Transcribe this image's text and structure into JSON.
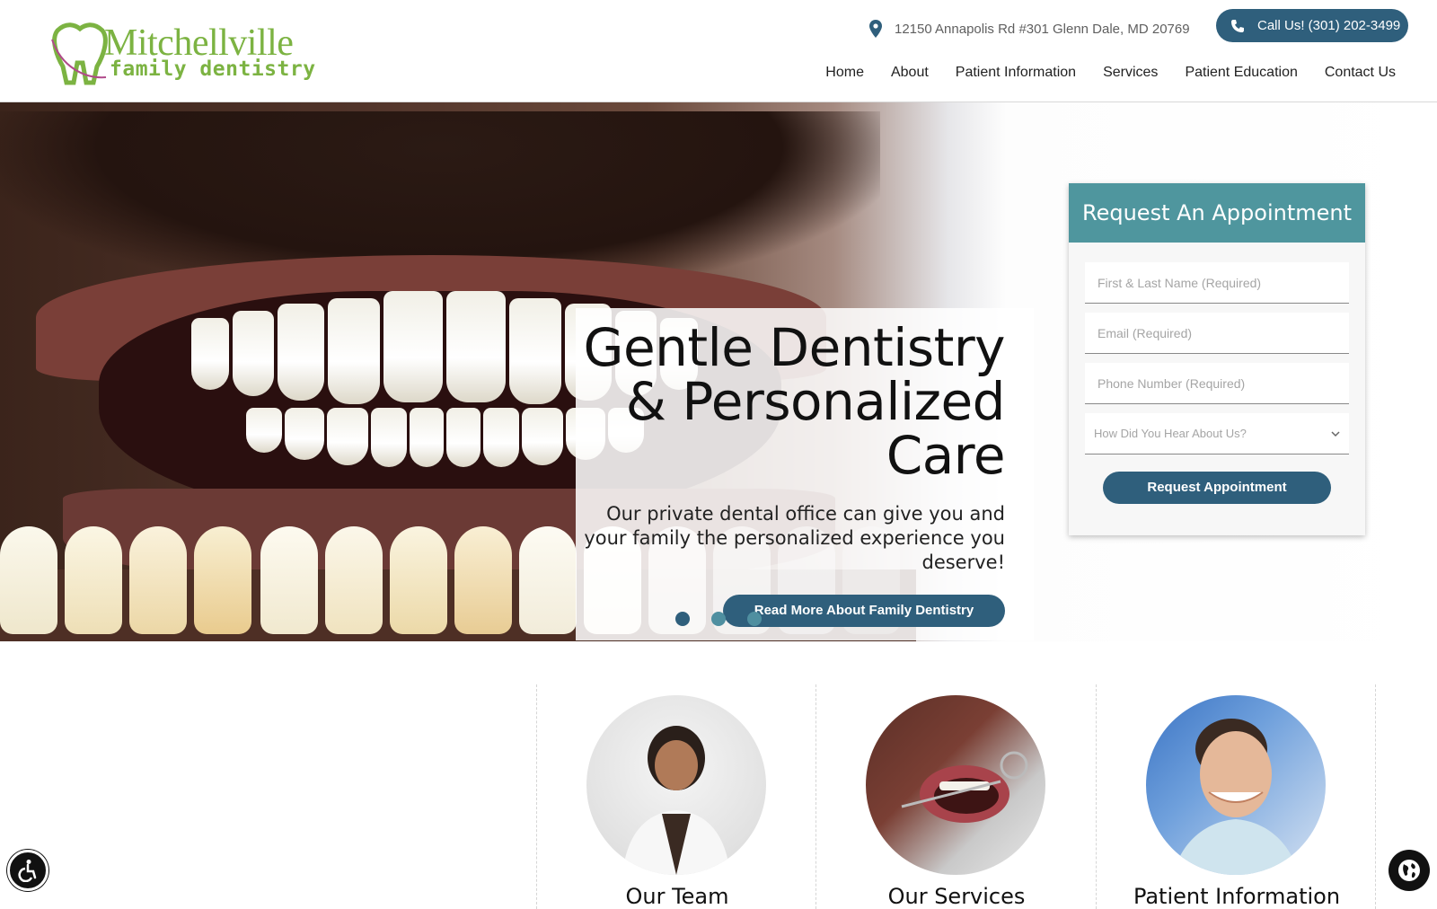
{
  "header": {
    "logo": {
      "name": "Mitchellville",
      "sub": "family dentistry"
    },
    "address": "12150 Annapolis Rd #301 Glenn Dale, MD 20769",
    "call_label": "Call Us! (301) 202-3499",
    "nav": [
      "Home",
      "About",
      "Patient Information",
      "Services",
      "Patient Education",
      "Contact Us"
    ]
  },
  "hero": {
    "title": "Gentle Dentistry & Personalized Care",
    "text": "Our private dental office can give you and your family the personalized experience you deserve!",
    "button": "Read More About Family Dentistry",
    "slides": 3,
    "active_slide": 1
  },
  "appointment": {
    "title": "Request An Appointment",
    "name_placeholder": "First & Last Name (Required)",
    "email_placeholder": "Email (Required)",
    "phone_placeholder": "Phone Number (Required)",
    "source_placeholder": "How Did You Hear About Us?",
    "submit": "Request Appointment"
  },
  "features": [
    {
      "title": "Our Team"
    },
    {
      "title": "Our Services"
    },
    {
      "title": "Patient Information"
    }
  ],
  "colors": {
    "brand_green": "#7cb342",
    "button_blue": "#2f5f7c",
    "form_teal": "#4f969e"
  },
  "icons": {
    "address": "map-pin-icon",
    "call": "phone-icon",
    "accessibility": "accessibility-icon",
    "language": "globe-icon"
  }
}
